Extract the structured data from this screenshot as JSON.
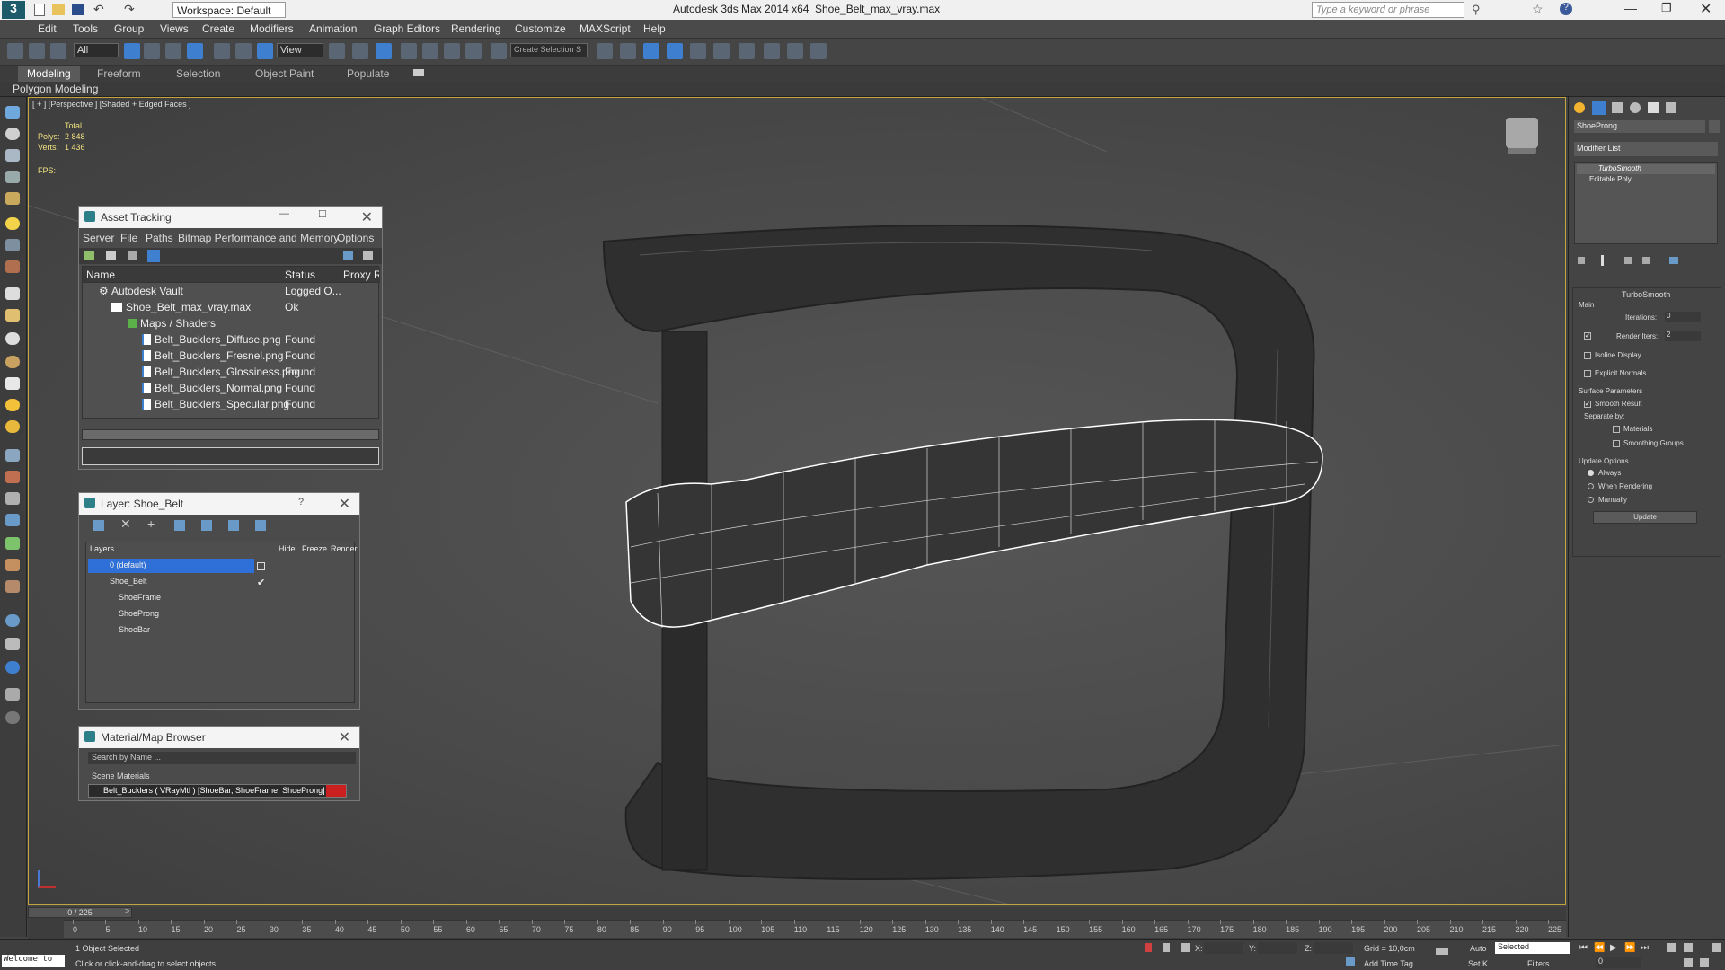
{
  "titlebar": {
    "app": "Autodesk 3ds Max  2014 x64",
    "file": "Shoe_Belt_max_vray.max",
    "workspace": "Workspace: Default",
    "search_placeholder": "Type a keyword or phrase"
  },
  "menu": [
    "Edit",
    "Tools",
    "Group",
    "Views",
    "Create",
    "Modifiers",
    "Animation",
    "Graph Editors",
    "Rendering",
    "Customize",
    "MAXScript",
    "Help"
  ],
  "toolbar": {
    "filter": "All",
    "view": "View",
    "selection_set": "Create Selection S"
  },
  "ribbon": {
    "tabs": [
      "Modeling",
      "Freeform",
      "Selection",
      "Object Paint",
      "Populate"
    ],
    "sub": "Polygon Modeling"
  },
  "viewport": {
    "label": "[ + ] [Perspective ] [Shaded + Edged Faces ]",
    "stats": {
      "total": "Total",
      "polys_label": "Polys:",
      "polys": "2 848",
      "verts_label": "Verts:",
      "verts": "1 436",
      "fps": "FPS:"
    }
  },
  "asset_tracking": {
    "title": "Asset Tracking",
    "menu": [
      "Server",
      "File",
      "Paths",
      "Bitmap Performance and Memory",
      "Options"
    ],
    "columns": [
      "Name",
      "Status",
      "Proxy Re"
    ],
    "rows": [
      {
        "name": "Autodesk Vault",
        "status": "Logged O..."
      },
      {
        "name": "Shoe_Belt_max_vray.max",
        "status": "Ok"
      },
      {
        "name": "Maps / Shaders",
        "status": ""
      },
      {
        "name": "Belt_Bucklers_Diffuse.png",
        "status": "Found"
      },
      {
        "name": "Belt_Bucklers_Fresnel.png",
        "status": "Found"
      },
      {
        "name": "Belt_Bucklers_Glossiness.png",
        "status": "Found"
      },
      {
        "name": "Belt_Bucklers_Normal.png",
        "status": "Found"
      },
      {
        "name": "Belt_Bucklers_Specular.png",
        "status": "Found"
      }
    ]
  },
  "layer": {
    "title": "Layer: Shoe_Belt",
    "help": "?",
    "columns": [
      "Layers",
      "Hide",
      "Freeze",
      "Render"
    ],
    "rows": [
      {
        "name": "0 (default)"
      },
      {
        "name": "Shoe_Belt"
      },
      {
        "name": "ShoeFrame"
      },
      {
        "name": "ShoeProng"
      },
      {
        "name": "ShoeBar"
      }
    ]
  },
  "material_browser": {
    "title": "Material/Map Browser",
    "search": "Search by Name ...",
    "section": "Scene Materials",
    "item": "Belt_Bucklers  ( VRayMtl ) [ShoeBar, ShoeFrame, ShoeProng]"
  },
  "command_panel": {
    "object_name": "ShoeProng",
    "modifier_list": "Modifier List",
    "stack": [
      "TurboSmooth",
      "Editable Poly"
    ],
    "rollout": "TurboSmooth",
    "main": "Main",
    "iterations_label": "Iterations:",
    "iterations": "0",
    "render_iters_label": "Render Iters:",
    "render_iters": "2",
    "isoline": "Isoline Display",
    "explicit": "Explicit Normals",
    "surface": "Surface Parameters",
    "smooth_result": "Smooth Result",
    "separate_by": "Separate by:",
    "materials": "Materials",
    "smoothing_groups": "Smoothing Groups",
    "update_options": "Update Options",
    "always": "Always",
    "when_rendering": "When Rendering",
    "manually": "Manually",
    "update": "Update"
  },
  "timeline": {
    "frame": "0 / 225",
    "ticks": [
      "0",
      "5",
      "10",
      "15",
      "20",
      "25",
      "30",
      "35",
      "40",
      "45",
      "50",
      "55",
      "60",
      "65",
      "70",
      "75",
      "80",
      "85",
      "90",
      "95",
      "100",
      "105",
      "110",
      "115",
      "120",
      "125",
      "130",
      "135",
      "140",
      "145",
      "150",
      "155",
      "160",
      "165",
      "170",
      "175",
      "180",
      "185",
      "190",
      "195",
      "200",
      "205",
      "210",
      "215",
      "220",
      "225"
    ]
  },
  "status": {
    "welcome": "Welcome to",
    "selected": "1 Object Selected",
    "hint": "Click or click-and-drag to select objects",
    "x": "X:",
    "y": "Y:",
    "z": "Z:",
    "grid": "Grid = 10,0cm",
    "add_time_tag": "Add Time Tag",
    "auto": "Auto",
    "set_k": "Set K.",
    "selected_dd": "Selected",
    "filters": "Filters...",
    "frame_field": "0"
  },
  "colors": {
    "accent": "#3f7fd0",
    "viewport_border": "#c4a43d",
    "selected_layer": "#2f6fd8",
    "material_swatch": "#cc1f1f"
  }
}
